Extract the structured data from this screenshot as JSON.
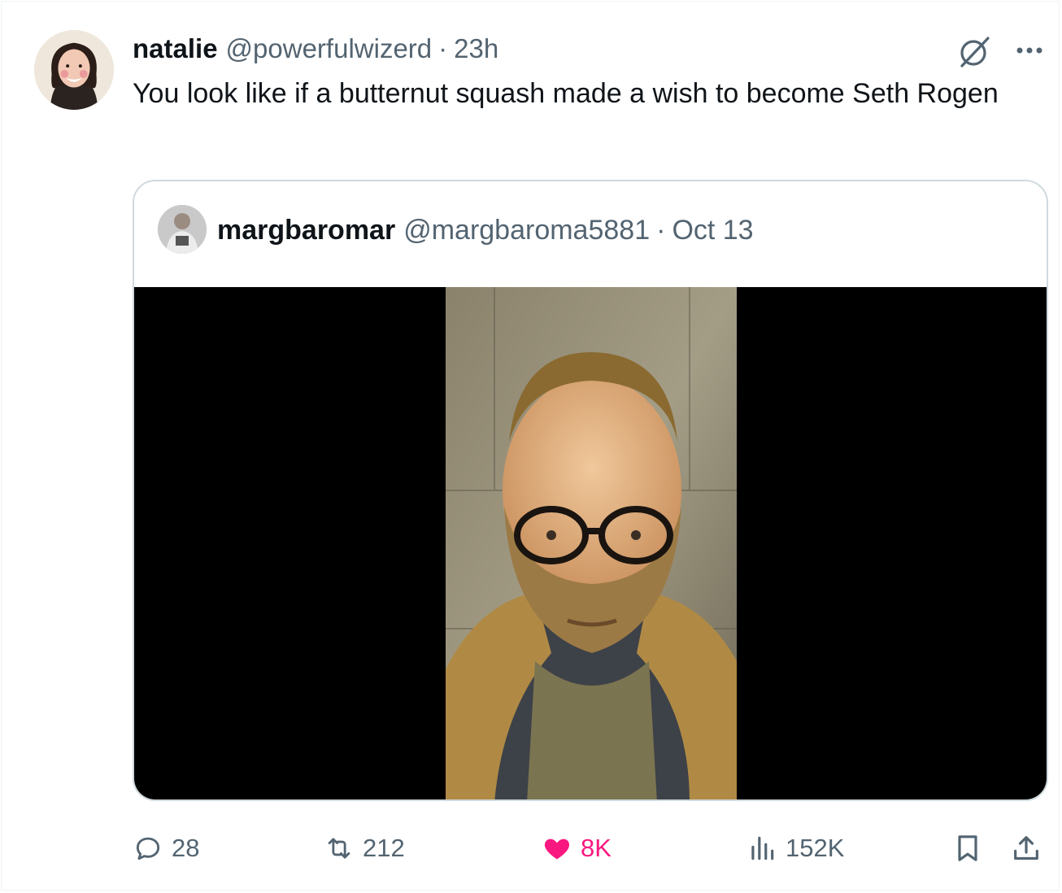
{
  "tweet": {
    "author_name": "natalie",
    "author_handle": "@powerfulwizerd",
    "separator": "·",
    "time": "23h",
    "text": "You look like if a butternut squash made a wish to become Seth Rogen",
    "avatar_icon": "user-avatar",
    "grok_icon": "grok-icon",
    "more_icon": "more-options-icon"
  },
  "quote": {
    "author_name": "margbaromar",
    "author_handle": "@margbaroma5881",
    "separator": "·",
    "date": "Oct 13",
    "avatar_icon": "user-avatar",
    "media": "video-thumbnail"
  },
  "actions": {
    "replies": "28",
    "reposts": "212",
    "likes": "8K",
    "views": "152K",
    "like_color": "#f91880",
    "muted_color": "#536471"
  }
}
